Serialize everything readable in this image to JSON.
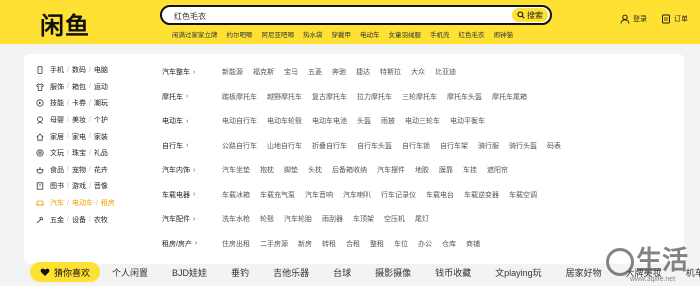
{
  "header": {
    "logo": "闲鱼",
    "search_value": "红色毛衣",
    "search_button": "搜索",
    "hot_terms": [
      "闲满过家家立牌",
      "约尔吧唧",
      "阿尼亚吧唧",
      "热水袋",
      "穿戴甲",
      "电动车",
      "女童羽绒服",
      "手机壳",
      "红色毛衣",
      "闹钟猫"
    ],
    "login": "登录",
    "orders": "订单"
  },
  "categories": [
    {
      "icon": "phone-icon",
      "parts": [
        "手机",
        "数码",
        "电脑"
      ]
    },
    {
      "icon": "clothes-icon",
      "parts": [
        "服饰",
        "箱包",
        "运动"
      ]
    },
    {
      "icon": "skill-icon",
      "parts": [
        "技能",
        "卡券",
        "潮玩"
      ]
    },
    {
      "icon": "baby-icon",
      "parts": [
        "母婴",
        "美妆",
        "个护"
      ]
    },
    {
      "icon": "home-icon",
      "parts": [
        "家居",
        "家电",
        "家装"
      ]
    },
    {
      "icon": "culture-icon",
      "parts": [
        "文玩",
        "珠宝",
        "礼品"
      ]
    },
    {
      "icon": "food-icon",
      "parts": [
        "食品",
        "宠物",
        "花卉"
      ]
    },
    {
      "icon": "book-icon",
      "parts": [
        "图书",
        "游戏",
        "音像"
      ]
    },
    {
      "icon": "car-icon",
      "parts": [
        "汽车",
        "电动车",
        "租房"
      ],
      "active": true
    },
    {
      "icon": "tools-icon",
      "parts": [
        "五金",
        "设备",
        "农牧"
      ]
    }
  ],
  "subcategories": [
    {
      "title": "汽车整车",
      "items": [
        "新能源",
        "福克斯",
        "宝马",
        "五菱",
        "奔驰",
        "捷达",
        "特斯拉",
        "大众",
        "比亚迪"
      ]
    },
    {
      "title": "摩托车",
      "items": [
        "踏板摩托车",
        "越野摩托车",
        "复古摩托车",
        "拉力摩托车",
        "三轮摩托车",
        "摩托车头盔",
        "摩托车尾箱"
      ]
    },
    {
      "title": "电动车",
      "items": [
        "电动自行车",
        "电动车轮毂",
        "电动车电池",
        "头盔",
        "雨披",
        "电动三轮车",
        "电动平衡车"
      ]
    },
    {
      "title": "自行车",
      "items": [
        "公路自行车",
        "山地自行车",
        "折叠自行车",
        "自行车头盔",
        "自行车锁",
        "自行车架",
        "骑行服",
        "骑行头盔",
        "码表"
      ]
    },
    {
      "title": "汽车内饰",
      "items": [
        "汽车坐垫",
        "抱枕",
        "脚垫",
        "头枕",
        "后备箱收纳",
        "汽车摆件",
        "地胶",
        "膜靠",
        "车挂",
        "遮阳帘"
      ]
    },
    {
      "title": "车载电器",
      "items": [
        "车载冰箱",
        "车载充气泵",
        "汽车音响",
        "汽车喇叭",
        "行车记录仪",
        "车载电台",
        "车载逆变器",
        "车载空调"
      ]
    },
    {
      "title": "汽车配件",
      "items": [
        "洗车水枪",
        "轮毂",
        "汽车轮胎",
        "雨刮器",
        "车顶架",
        "空压机",
        "尾灯"
      ]
    },
    {
      "title": "租房/房产",
      "items": [
        "住房出租",
        "二手房源",
        "新房",
        "转租",
        "合租",
        "整租",
        "车位",
        "办公",
        "仓库",
        "商铺"
      ]
    }
  ],
  "tabs": [
    "猜你喜欢",
    "个人闲置",
    "BJD娃娃",
    "垂钓",
    "吉他乐器",
    "台球",
    "摄影摄像",
    "钱币收藏",
    "文playing玩",
    "居家好物",
    "大牌美妆",
    "机车"
  ],
  "watermark": {
    "main": "生活",
    "sub": "www.3qlife.net"
  }
}
